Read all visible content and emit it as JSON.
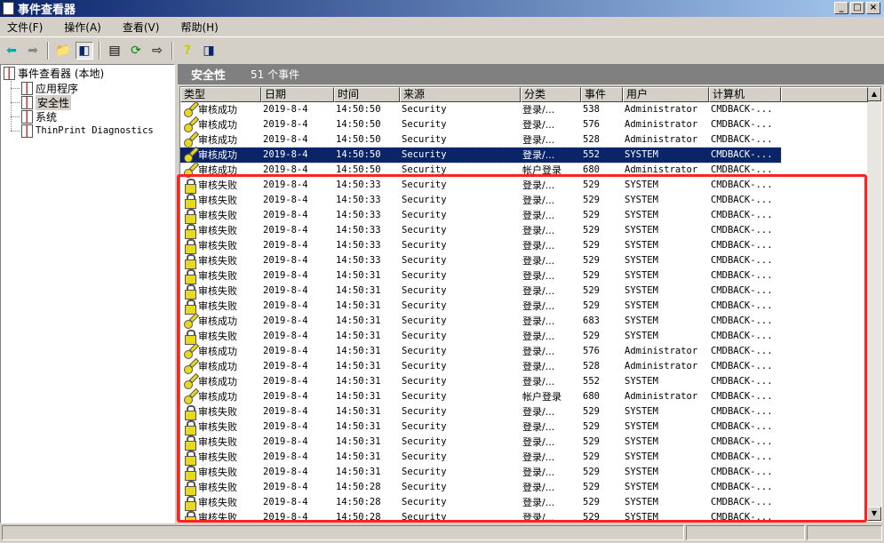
{
  "window": {
    "title": "事件查看器",
    "buttons": [
      "_",
      "□",
      "×"
    ]
  },
  "menu": [
    "文件(F)",
    "操作(A)",
    "查看(V)",
    "帮助(H)"
  ],
  "tree": {
    "root": "事件查看器 (本地)",
    "items": [
      "应用程序",
      "安全性",
      "系统",
      "ThinPrint Diagnostics"
    ],
    "selected": 1
  },
  "panel": {
    "title": "安全性",
    "count": "51 个事件"
  },
  "columns": [
    "类型",
    "日期",
    "时间",
    "来源",
    "分类",
    "事件",
    "用户",
    "计算机"
  ],
  "rows": [
    [
      "审核成功",
      "2019-8-4",
      "14:50:50",
      "Security",
      "登录/...",
      "538",
      "Administrator",
      "CMDBACK-..."
    ],
    [
      "审核成功",
      "2019-8-4",
      "14:50:50",
      "Security",
      "登录/...",
      "576",
      "Administrator",
      "CMDBACK-..."
    ],
    [
      "审核成功",
      "2019-8-4",
      "14:50:50",
      "Security",
      "登录/...",
      "528",
      "Administrator",
      "CMDBACK-..."
    ],
    [
      "审核成功",
      "2019-8-4",
      "14:50:50",
      "Security",
      "登录/...",
      "552",
      "SYSTEM",
      "CMDBACK-..."
    ],
    [
      "审核成功",
      "2019-8-4",
      "14:50:50",
      "Security",
      "帐户登录",
      "680",
      "Administrator",
      "CMDBACK-..."
    ],
    [
      "审核失败",
      "2019-8-4",
      "14:50:33",
      "Security",
      "登录/...",
      "529",
      "SYSTEM",
      "CMDBACK-..."
    ],
    [
      "审核失败",
      "2019-8-4",
      "14:50:33",
      "Security",
      "登录/...",
      "529",
      "SYSTEM",
      "CMDBACK-..."
    ],
    [
      "审核失败",
      "2019-8-4",
      "14:50:33",
      "Security",
      "登录/...",
      "529",
      "SYSTEM",
      "CMDBACK-..."
    ],
    [
      "审核失败",
      "2019-8-4",
      "14:50:33",
      "Security",
      "登录/...",
      "529",
      "SYSTEM",
      "CMDBACK-..."
    ],
    [
      "审核失败",
      "2019-8-4",
      "14:50:33",
      "Security",
      "登录/...",
      "529",
      "SYSTEM",
      "CMDBACK-..."
    ],
    [
      "审核失败",
      "2019-8-4",
      "14:50:33",
      "Security",
      "登录/...",
      "529",
      "SYSTEM",
      "CMDBACK-..."
    ],
    [
      "审核失败",
      "2019-8-4",
      "14:50:31",
      "Security",
      "登录/...",
      "529",
      "SYSTEM",
      "CMDBACK-..."
    ],
    [
      "审核失败",
      "2019-8-4",
      "14:50:31",
      "Security",
      "登录/...",
      "529",
      "SYSTEM",
      "CMDBACK-..."
    ],
    [
      "审核失败",
      "2019-8-4",
      "14:50:31",
      "Security",
      "登录/...",
      "529",
      "SYSTEM",
      "CMDBACK-..."
    ],
    [
      "审核成功",
      "2019-8-4",
      "14:50:31",
      "Security",
      "登录/...",
      "683",
      "SYSTEM",
      "CMDBACK-..."
    ],
    [
      "审核失败",
      "2019-8-4",
      "14:50:31",
      "Security",
      "登录/...",
      "529",
      "SYSTEM",
      "CMDBACK-..."
    ],
    [
      "审核成功",
      "2019-8-4",
      "14:50:31",
      "Security",
      "登录/...",
      "576",
      "Administrator",
      "CMDBACK-..."
    ],
    [
      "审核成功",
      "2019-8-4",
      "14:50:31",
      "Security",
      "登录/...",
      "528",
      "Administrator",
      "CMDBACK-..."
    ],
    [
      "审核成功",
      "2019-8-4",
      "14:50:31",
      "Security",
      "登录/...",
      "552",
      "SYSTEM",
      "CMDBACK-..."
    ],
    [
      "审核成功",
      "2019-8-4",
      "14:50:31",
      "Security",
      "帐户登录",
      "680",
      "Administrator",
      "CMDBACK-..."
    ],
    [
      "审核失败",
      "2019-8-4",
      "14:50:31",
      "Security",
      "登录/...",
      "529",
      "SYSTEM",
      "CMDBACK-..."
    ],
    [
      "审核失败",
      "2019-8-4",
      "14:50:31",
      "Security",
      "登录/...",
      "529",
      "SYSTEM",
      "CMDBACK-..."
    ],
    [
      "审核失败",
      "2019-8-4",
      "14:50:31",
      "Security",
      "登录/...",
      "529",
      "SYSTEM",
      "CMDBACK-..."
    ],
    [
      "审核失败",
      "2019-8-4",
      "14:50:31",
      "Security",
      "登录/...",
      "529",
      "SYSTEM",
      "CMDBACK-..."
    ],
    [
      "审核失败",
      "2019-8-4",
      "14:50:31",
      "Security",
      "登录/...",
      "529",
      "SYSTEM",
      "CMDBACK-..."
    ],
    [
      "审核失败",
      "2019-8-4",
      "14:50:28",
      "Security",
      "登录/...",
      "529",
      "SYSTEM",
      "CMDBACK-..."
    ],
    [
      "审核失败",
      "2019-8-4",
      "14:50:28",
      "Security",
      "登录/...",
      "529",
      "SYSTEM",
      "CMDBACK-..."
    ],
    [
      "审核失败",
      "2019-8-4",
      "14:50:28",
      "Security",
      "登录/...",
      "529",
      "SYSTEM",
      "CMDBACK-..."
    ]
  ],
  "selected_row": 3,
  "colors": {
    "selection": "#0a246a",
    "highlight_box": "#ff2222"
  }
}
